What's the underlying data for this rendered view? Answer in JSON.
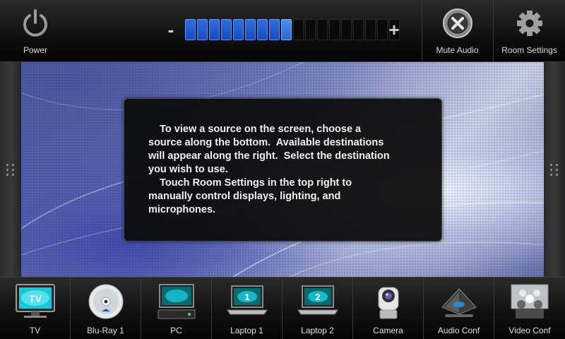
{
  "topbar": {
    "power_label": "Power",
    "volume_minus": "-",
    "volume_plus": "+",
    "volume_level": 0.5,
    "volume_segments": 18,
    "mute_label": "Mute Audio",
    "settings_label": "Room Settings"
  },
  "info": {
    "message": "    To view a source on the screen, choose a\nsource along the bottom.  Available destinations\nwill appear along the right.  Select the destination\nyou wish to use.\n    Touch Room Settings in the top right to\nmanually control displays, lighting, and\nmicrophones."
  },
  "sources": [
    {
      "label": "TV",
      "icon": "tv-icon",
      "badge": "TV"
    },
    {
      "label": "Blu-Ray 1",
      "icon": "bluray-disc-icon",
      "badge": ""
    },
    {
      "label": "PC",
      "icon": "pc-icon",
      "badge": ""
    },
    {
      "label": "Laptop 1",
      "icon": "laptop-icon",
      "badge": "1"
    },
    {
      "label": "Laptop 2",
      "icon": "laptop-icon",
      "badge": "2"
    },
    {
      "label": "Camera",
      "icon": "camera-icon",
      "badge": ""
    },
    {
      "label": "Audio Conf",
      "icon": "conference-phone-icon",
      "badge": ""
    },
    {
      "label": "Video Conf",
      "icon": "video-conference-icon",
      "badge": ""
    }
  ],
  "colors": {
    "volume_on": "#2f6fe0",
    "volume_off": "#0a0a0a",
    "screen_glow": "#18c8d8"
  }
}
